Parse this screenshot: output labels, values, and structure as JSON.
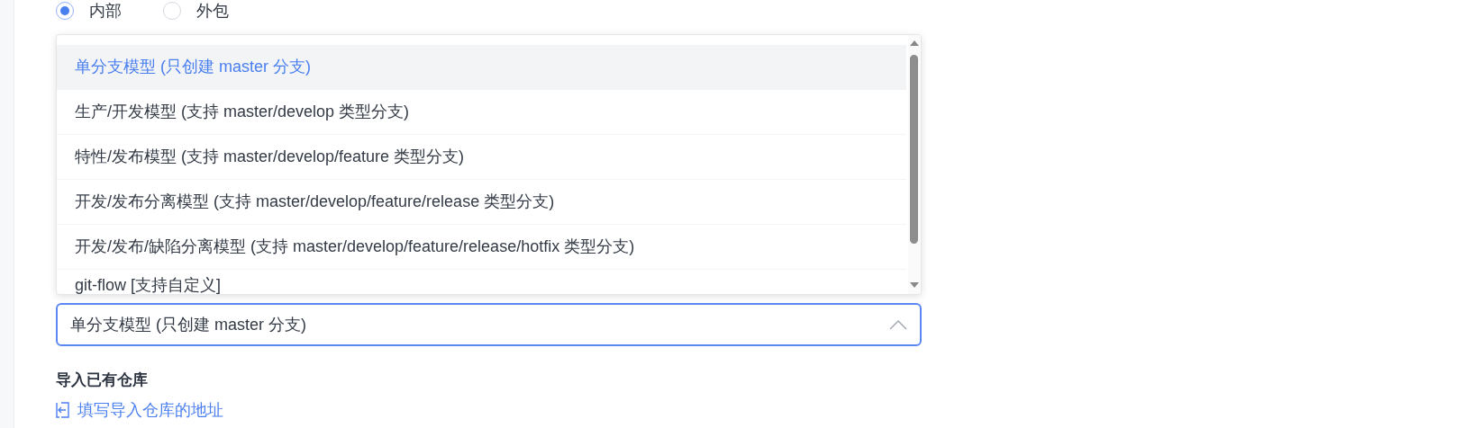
{
  "radios": [
    {
      "label": "内部",
      "selected": true
    },
    {
      "label": "外包",
      "selected": false
    }
  ],
  "dropdown": {
    "options": [
      {
        "label": "单分支模型 (只创建 master 分支)",
        "selected": true
      },
      {
        "label": "生产/开发模型 (支持 master/develop 类型分支)",
        "selected": false
      },
      {
        "label": "特性/发布模型 (支持 master/develop/feature 类型分支)",
        "selected": false
      },
      {
        "label": "开发/发布分离模型 (支持 master/develop/feature/release 类型分支)",
        "selected": false
      },
      {
        "label": "开发/发布/缺陷分离模型 (支持 master/develop/feature/release/hotfix 类型分支)",
        "selected": false
      },
      {
        "label": "git-flow [支持自定义]",
        "selected": false
      }
    ]
  },
  "select": {
    "value": "单分支模型 (只创建 master 分支)",
    "expanded": true
  },
  "import_section": {
    "title": "导入已有仓库",
    "link": "填写导入仓库的地址"
  }
}
